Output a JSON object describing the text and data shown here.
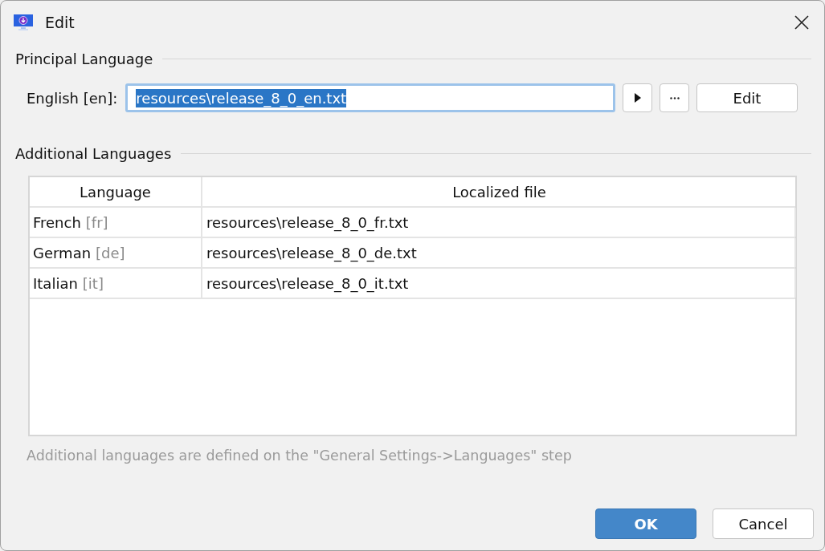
{
  "window": {
    "title": "Edit"
  },
  "principal": {
    "heading": "Principal Language",
    "label": "English [en]:",
    "field": {
      "value": "resources\\release_8_0_en.txt",
      "selected": true,
      "focused": true
    },
    "buttons": [
      {
        "kind": "play"
      },
      {
        "kind": "more"
      },
      {
        "kind": "text",
        "label": "Edit"
      }
    ]
  },
  "additional": {
    "heading": "Additional Languages",
    "table": {
      "columns": [
        "Language",
        "Localized file"
      ],
      "rows": [
        {
          "language": "French",
          "code": "[fr]",
          "file": "resources\\release_8_0_fr.txt"
        },
        {
          "language": "German",
          "code": "[de]",
          "file": "resources\\release_8_0_de.txt"
        },
        {
          "language": "Italian",
          "code": "[it]",
          "file": "resources\\release_8_0_it.txt"
        }
      ]
    },
    "note": "Additional languages are defined on the \"General Settings->Languages\" step"
  },
  "buttons": [
    {
      "label": "OK",
      "default": true
    },
    {
      "label": "Cancel",
      "default": false
    }
  ]
}
